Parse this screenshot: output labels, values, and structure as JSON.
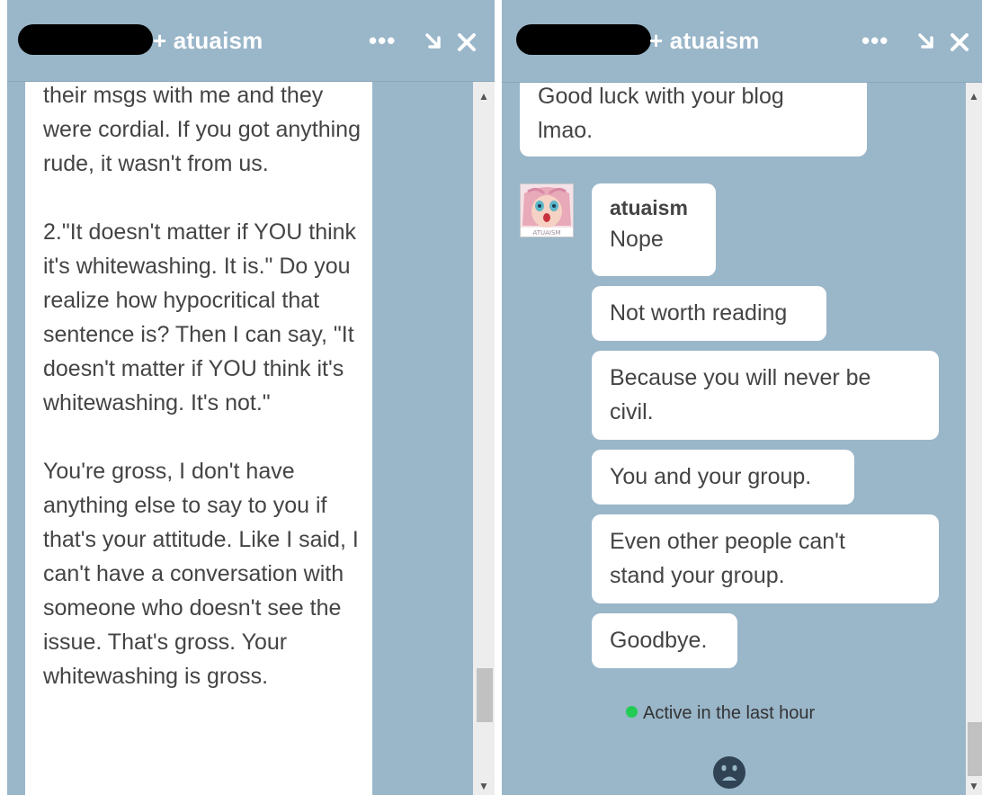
{
  "left_window": {
    "title": "+ atuaism",
    "paragraphs": [
      "their msgs with me and they were cordial. If you got anything rude, it wasn't from us.",
      "2.\"It doesn't matter if YOU think it's whitewashing. It is.\" Do you realize how hypocritical that sentence is? Then I can say, \"It doesn't matter if YOU think it's whitewashing. It's not.\"",
      "You're gross, I don't have anything else to say to you if that's your attitude. Like I said, I can't have a conversation with someone who doesn't see the issue. That's gross. Your whitewashing is gross."
    ]
  },
  "right_window": {
    "title": "+ atuaism",
    "prev_message": "Good luck with your blog lmao.",
    "sender": "atuaism",
    "messages": [
      "Nope",
      "Not worth reading",
      "Because you will never be civil.",
      "You and your group.",
      "Even other people can't stand your group.",
      "Goodbye."
    ],
    "status": "Active in the last hour"
  },
  "icons": {
    "more": "more-dots-icon",
    "minimize": "minimize-arrow-icon",
    "close": "close-icon",
    "emoji": "sad-face-emoji-icon"
  },
  "colors": {
    "panel": "#9ab6c9",
    "bubble": "#ffffff",
    "text": "#444444",
    "status_dot": "#22cc55"
  }
}
